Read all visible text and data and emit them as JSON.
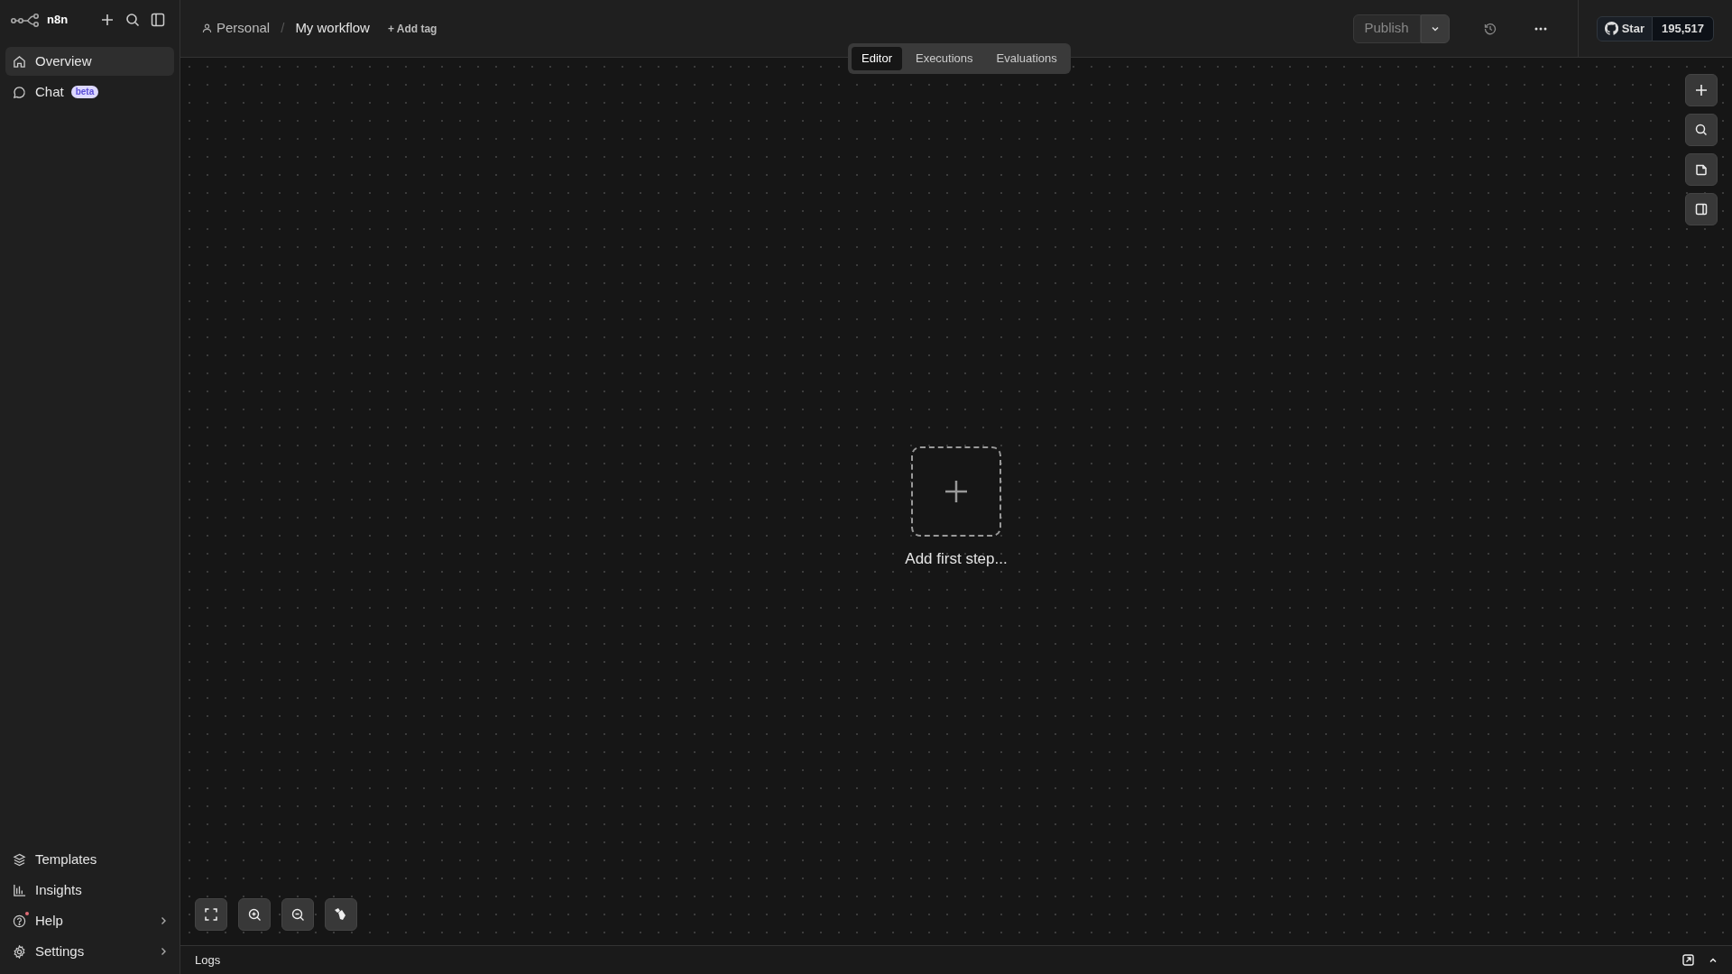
{
  "app": {
    "name": "n8n"
  },
  "sidebar": {
    "items": [
      {
        "label": "Overview",
        "selected": true
      },
      {
        "label": "Chat",
        "selected": false,
        "badge": "beta"
      }
    ],
    "footer_items": [
      {
        "label": "Templates",
        "expandable": false,
        "notification": false
      },
      {
        "label": "Insights",
        "expandable": false,
        "notification": false
      },
      {
        "label": "Help",
        "expandable": true,
        "notification": true
      },
      {
        "label": "Settings",
        "expandable": true,
        "notification": false
      }
    ]
  },
  "header": {
    "breadcrumb": {
      "project": "Personal",
      "separator": "/",
      "workflow": "My workflow"
    },
    "add_tag": "+ Add tag",
    "publish": {
      "label": "Publish",
      "disabled": true
    },
    "github": {
      "label": "Star",
      "count": "195,517"
    }
  },
  "tabs": [
    {
      "label": "Editor",
      "selected": true
    },
    {
      "label": "Executions",
      "selected": false
    },
    {
      "label": "Evaluations",
      "selected": false
    }
  ],
  "canvas": {
    "empty_label": "Add first step..."
  },
  "logs": {
    "label": "Logs"
  }
}
